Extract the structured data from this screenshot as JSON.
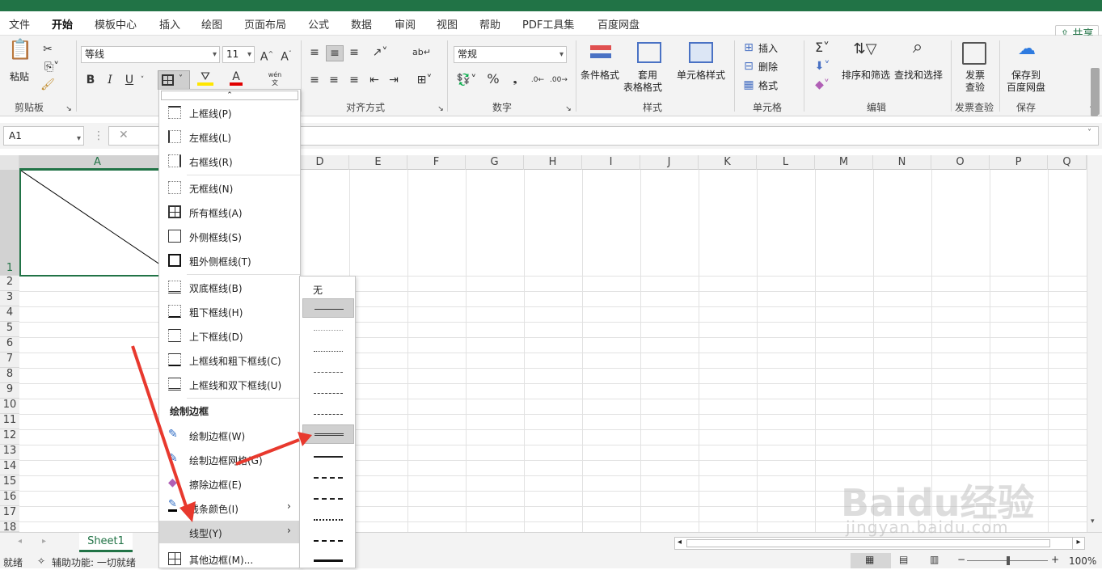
{
  "ribbon_tabs": [
    "文件",
    "开始",
    "模板中心",
    "插入",
    "绘图",
    "页面布局",
    "公式",
    "数据",
    "审阅",
    "视图",
    "帮助",
    "PDF工具集",
    "百度网盘"
  ],
  "share_label": "共享",
  "clipboard": {
    "paste": "粘贴",
    "group": "剪贴板"
  },
  "font": {
    "name": "等线",
    "size": "11",
    "bold": "B",
    "italic": "I",
    "underline": "U",
    "grow": "A^",
    "shrink": "A˅",
    "pinyin": "wén"
  },
  "alignment": {
    "group": "对齐方式"
  },
  "number": {
    "format": "常规",
    "group": "数字",
    "percent": "%"
  },
  "styles": {
    "conditional": "条件格式",
    "table_1": "套用",
    "table_2": "表格格式",
    "cell_styles": "单元格样式",
    "group": "样式"
  },
  "cells": {
    "insert": "插入",
    "delete": "删除",
    "format": "格式",
    "group": "单元格"
  },
  "editing": {
    "sort": "排序和筛选",
    "find": "查找和选择",
    "group": "编辑"
  },
  "invoice": {
    "l1": "发票",
    "l2": "查验",
    "group": "发票查验"
  },
  "save": {
    "l1": "保存到",
    "l2": "百度网盘",
    "group": "保存"
  },
  "namebox": "A1",
  "columns": [
    "A",
    "D",
    "E",
    "F",
    "G",
    "H",
    "I",
    "J",
    "K",
    "L",
    "M",
    "N",
    "O",
    "P",
    "Q"
  ],
  "rows": [
    "1",
    "2",
    "3",
    "4",
    "5",
    "6",
    "7",
    "8",
    "9",
    "10",
    "11",
    "12",
    "13",
    "14",
    "15",
    "16",
    "17",
    "18"
  ],
  "sheet_tab": "Sheet1",
  "status": {
    "ready": "就绪",
    "accessibility": "辅助功能: 一切就绪",
    "zoom": "100%"
  },
  "border_menu": {
    "items": [
      "上框线(P)",
      "左框线(L)",
      "右框线(R)",
      "无框线(N)",
      "所有框线(A)",
      "外侧框线(S)",
      "粗外侧框线(T)",
      "双底框线(B)",
      "粗下框线(H)",
      "上下框线(D)",
      "上框线和粗下框线(C)",
      "上框线和双下框线(U)"
    ],
    "draw_header": "绘制边框",
    "draw_items": [
      "绘制边框(W)",
      "绘制边框网格(G)",
      "擦除边框(E)",
      "线条颜色(I)",
      "线型(Y)",
      "其他边框(M)..."
    ]
  },
  "line_style_menu": {
    "none": "无"
  },
  "watermark": {
    "brand": "Baidu经验",
    "url": "jingyan.baidu.com"
  },
  "colors": {
    "accent": "#217346",
    "arrow": "#e8392e"
  }
}
